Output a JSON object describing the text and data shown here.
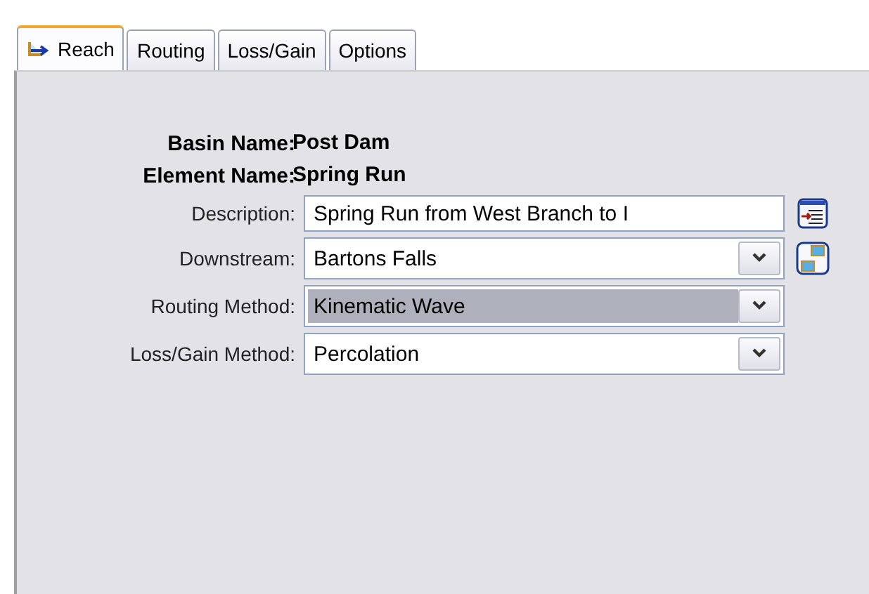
{
  "tabs": [
    {
      "label": "Reach",
      "selected": true
    },
    {
      "label": "Routing",
      "selected": false
    },
    {
      "label": "Loss/Gain",
      "selected": false
    },
    {
      "label": "Options",
      "selected": false
    }
  ],
  "info": [
    {
      "label": "Basin Name:",
      "value": "Post Dam"
    },
    {
      "label": "Element Name:",
      "value": "Spring Run"
    }
  ],
  "fields": [
    {
      "kind": "text",
      "label": "Description:",
      "value": "Spring Run from West Branch to I",
      "has_button": true,
      "highlighted": false
    },
    {
      "kind": "select",
      "label": "Downstream:",
      "value": "Bartons Falls",
      "has_button": true,
      "highlighted": false
    },
    {
      "kind": "select",
      "label": "Routing Method:",
      "value": "Kinematic Wave",
      "has_button": false,
      "highlighted": true
    },
    {
      "kind": "select",
      "label": "Loss/Gain Method:",
      "value": "Percolation",
      "has_button": false,
      "highlighted": false
    }
  ]
}
